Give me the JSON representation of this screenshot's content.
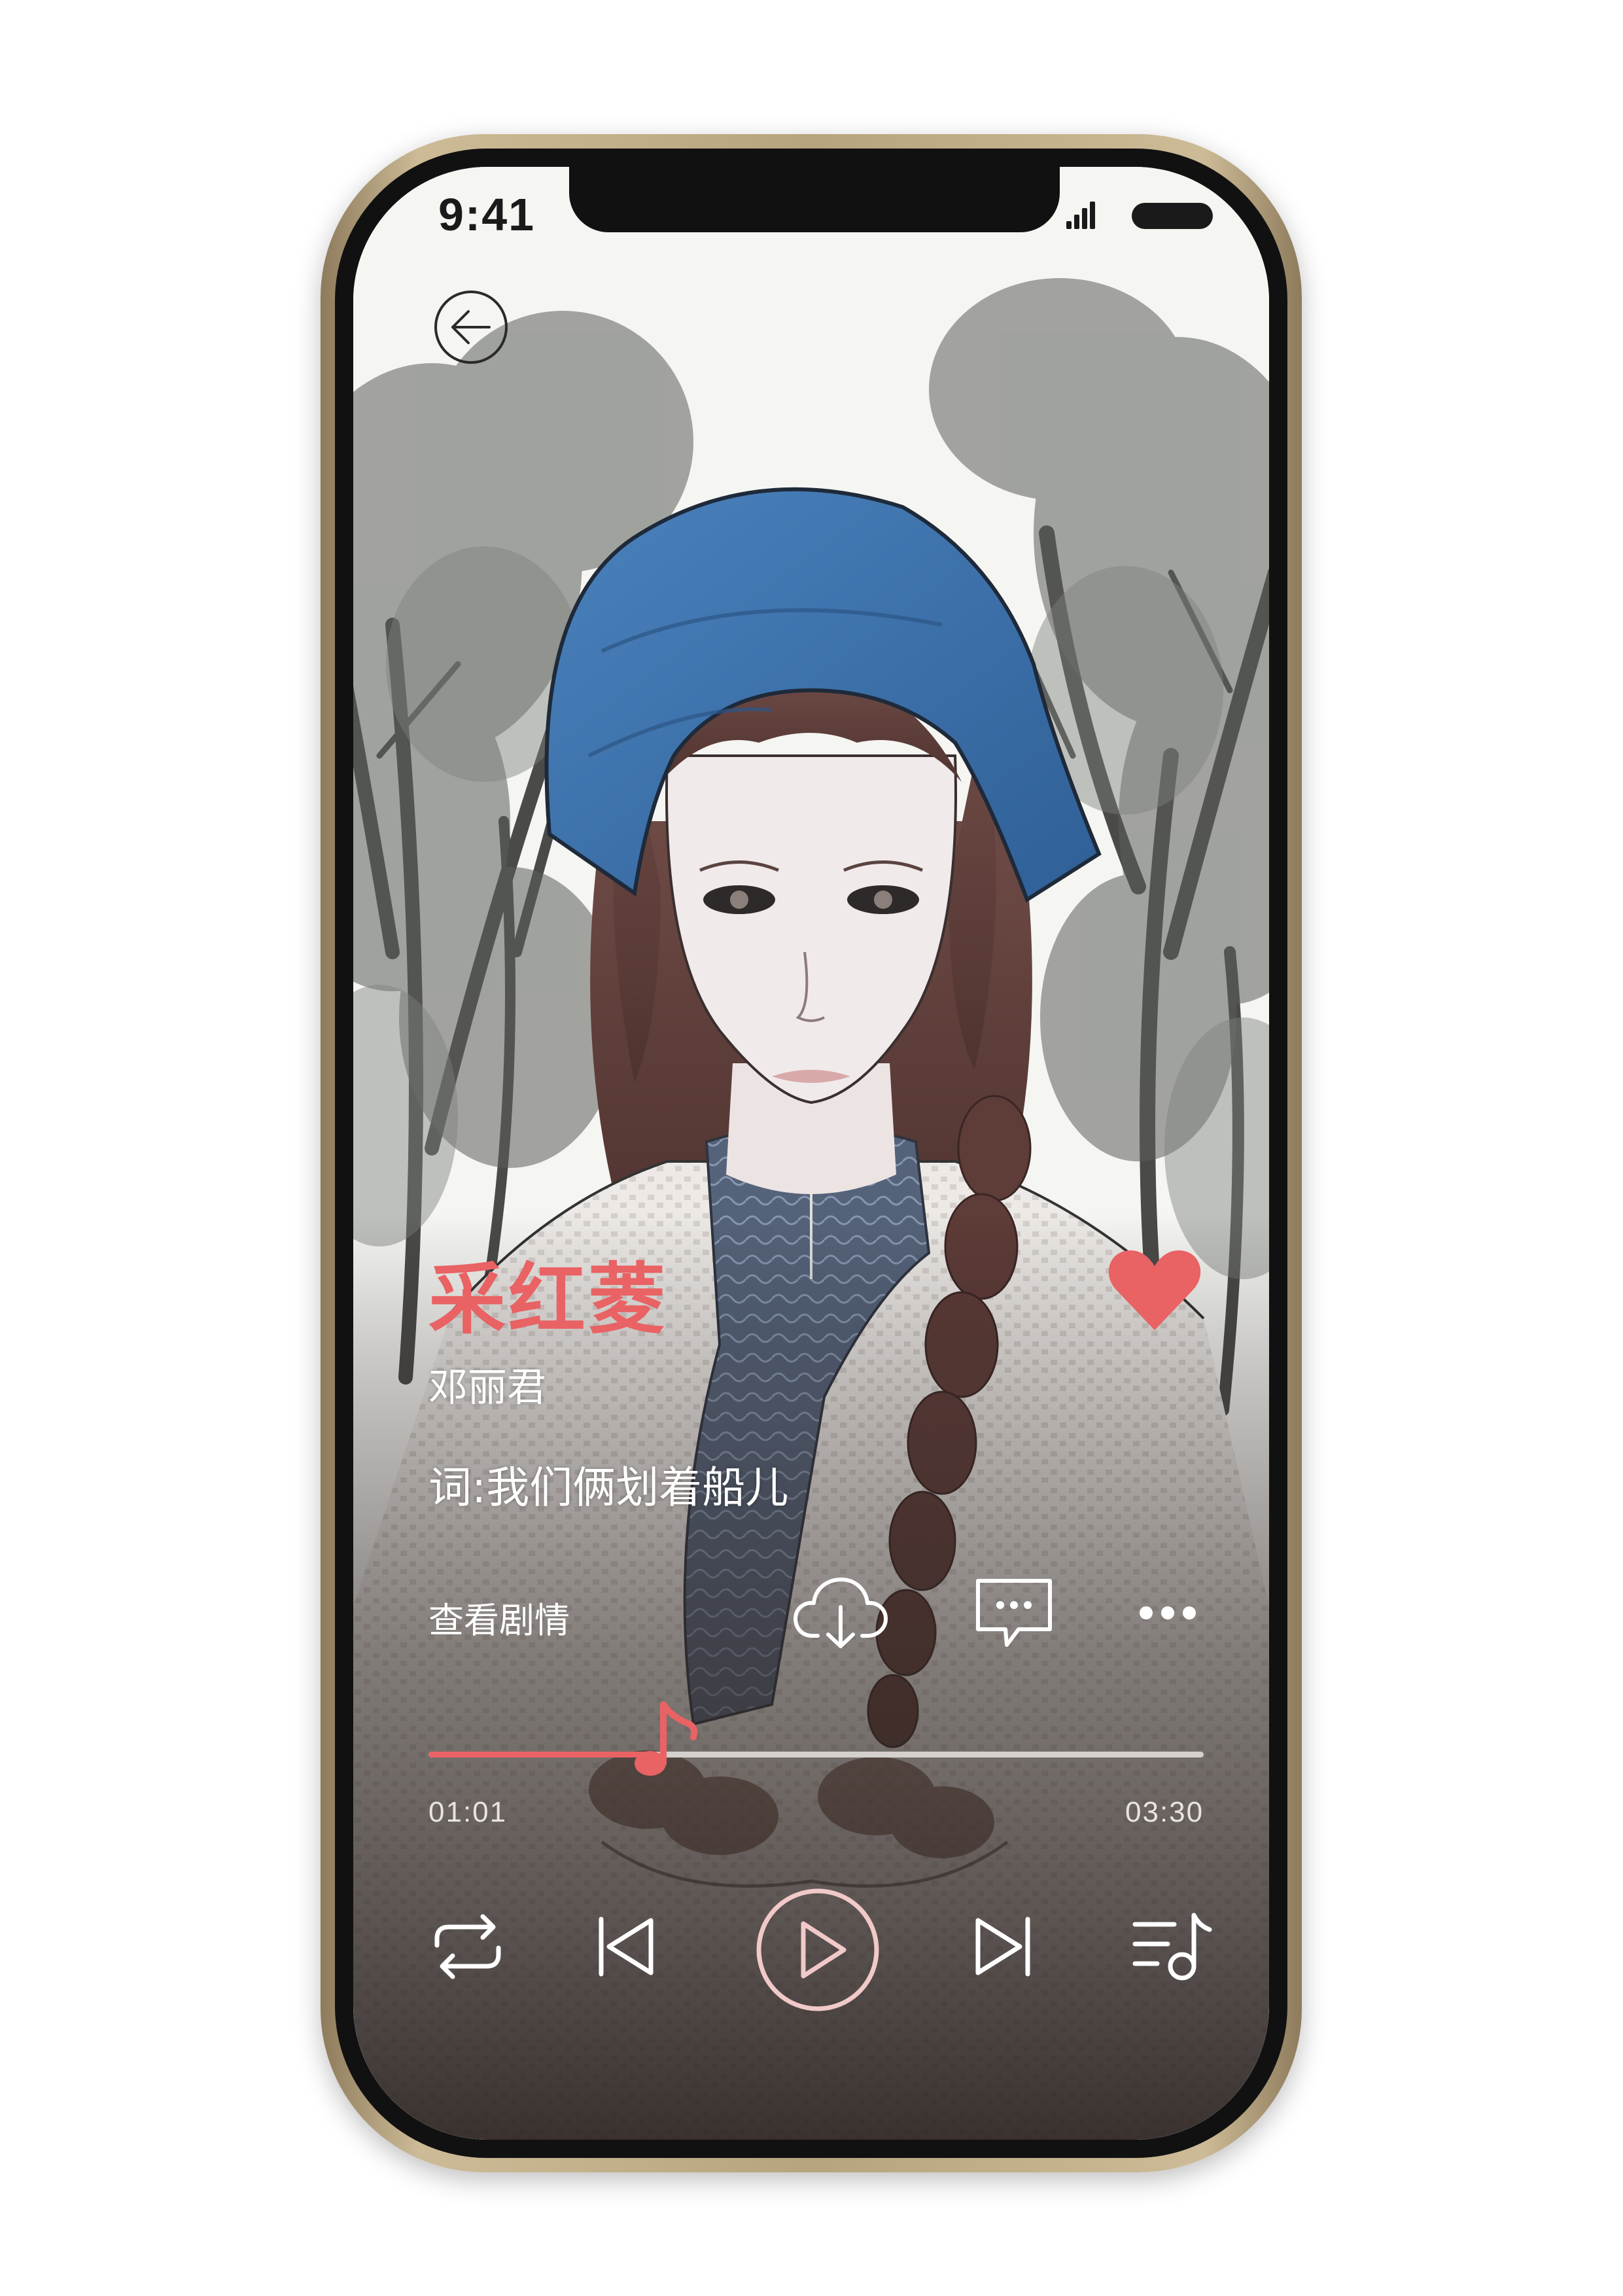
{
  "status_bar": {
    "time": "9:41",
    "signal_icon": "signal-bars-icon",
    "battery_icon": "battery-icon"
  },
  "navigation": {
    "back_icon": "arrow-left-circle-icon"
  },
  "song": {
    "title": "采红菱",
    "artist": "邓丽君",
    "lyrics_line": "词:我们俩划着船儿",
    "liked": true
  },
  "actions": {
    "view_story_label": "查看剧情",
    "download_icon": "cloud-download-icon",
    "comment_icon": "comment-bubble-icon",
    "more_icon": "more-dots-icon"
  },
  "playback": {
    "current_time": "01:01",
    "total_time": "03:30",
    "progress": 0.29,
    "handle_icon": "music-note-icon"
  },
  "controls": {
    "repeat_icon": "repeat-icon",
    "previous_icon": "skip-previous-icon",
    "play_icon": "play-circle-icon",
    "next_icon": "skip-next-icon",
    "playlist_icon": "playlist-icon"
  },
  "colors": {
    "accent": "#e96264",
    "text_light": "#ffffff",
    "headscarf_blue": "#3e70a8",
    "frame_gold": "#c2ae87"
  }
}
